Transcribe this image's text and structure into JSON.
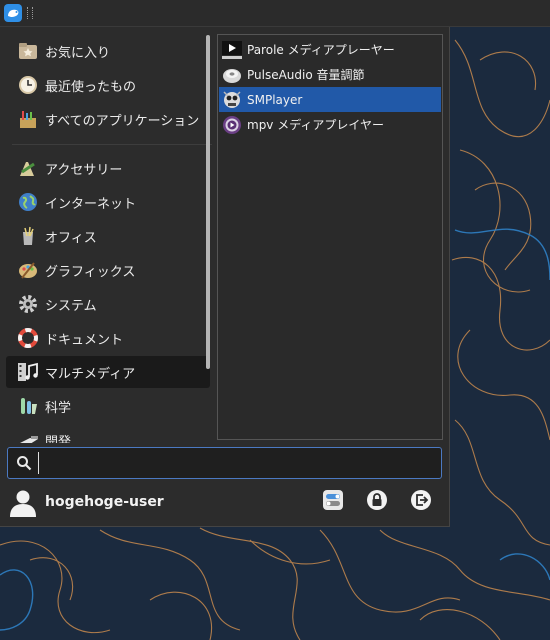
{
  "menu": {
    "categories": [
      {
        "label": "お気に入り",
        "icon": "favorites-folder-icon"
      },
      {
        "label": "最近使ったもの",
        "icon": "recent-clock-icon"
      },
      {
        "label": "すべてのアプリケーション",
        "icon": "all-applications-icon"
      },
      {
        "label": "アクセサリー",
        "icon": "accessories-icon"
      },
      {
        "label": "インターネット",
        "icon": "internet-globe-icon"
      },
      {
        "label": "オフィス",
        "icon": "office-icon"
      },
      {
        "label": "グラフィックス",
        "icon": "graphics-palette-icon"
      },
      {
        "label": "システム",
        "icon": "system-gear-icon"
      },
      {
        "label": "ドキュメント",
        "icon": "help-lifebuoy-icon"
      },
      {
        "label": "マルチメディア",
        "icon": "multimedia-icon"
      },
      {
        "label": "科学",
        "icon": "science-flask-icon"
      },
      {
        "label": "開発",
        "icon": "development-trowel-icon"
      }
    ],
    "active_category": "マルチメディア",
    "apps": [
      {
        "label": "Parole メディアプレーヤー",
        "icon": "parole-play-icon"
      },
      {
        "label": "PulseAudio 音量調節",
        "icon": "pulseaudio-speaker-icon"
      },
      {
        "label": "SMPlayer",
        "icon": "smplayer-icon"
      },
      {
        "label": "mpv メディアプレイヤー",
        "icon": "mpv-icon"
      }
    ],
    "selected_app": "SMPlayer",
    "search": {
      "value": "",
      "placeholder": ""
    },
    "user": {
      "name": "hogehoge-user"
    },
    "actions": [
      {
        "name": "settings",
        "icon": "settings-toggle-icon"
      },
      {
        "name": "lock-screen",
        "icon": "lock-icon"
      },
      {
        "name": "log-out",
        "icon": "logout-icon"
      }
    ]
  },
  "colors": {
    "menu_bg": "#2c2c2c",
    "selection": "#2159a8",
    "active_category_bg": "#1a1a1a",
    "search_border": "#4b79c2",
    "wallpaper": "#1b2a3e",
    "contour_orange": "#c78a4e",
    "contour_blue": "#2f7fc4"
  }
}
